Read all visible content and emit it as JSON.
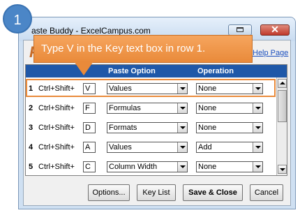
{
  "window": {
    "title": "aste Buddy - ExcelCampus.com",
    "restore_glyph": "restore-icon",
    "close_glyph": "✕",
    "brand_glyph": "P",
    "help_link": "Help Page"
  },
  "grid": {
    "headers": {
      "num": "",
      "ctrl": "",
      "key": "",
      "paste_option": "Paste Option",
      "operation": "Operation"
    },
    "rows": [
      {
        "num": "1",
        "ctrl": "Ctrl+Shift+",
        "key": "V",
        "paste_option": "Values",
        "operation": "None"
      },
      {
        "num": "2",
        "ctrl": "Ctrl+Shift+",
        "key": "F",
        "paste_option": "Formulas",
        "operation": "None"
      },
      {
        "num": "3",
        "ctrl": "Ctrl+Shift+",
        "key": "D",
        "paste_option": "Formats",
        "operation": "None"
      },
      {
        "num": "4",
        "ctrl": "Ctrl+Shift+",
        "key": "A",
        "paste_option": "Values",
        "operation": "Add"
      },
      {
        "num": "5",
        "ctrl": "Ctrl+Shift+",
        "key": "C",
        "paste_option": "Column Width",
        "operation": "None"
      }
    ]
  },
  "buttons": {
    "options": "Options...",
    "key_list": "Key List",
    "save_close": "Save & Close",
    "cancel": "Cancel"
  },
  "annotation": {
    "step": "1",
    "callout": "Type V in the Key text box in row 1."
  },
  "colors": {
    "accent": "#e98a3a",
    "header_blue": "#1f58a8",
    "badge_blue": "#4b86c7"
  }
}
